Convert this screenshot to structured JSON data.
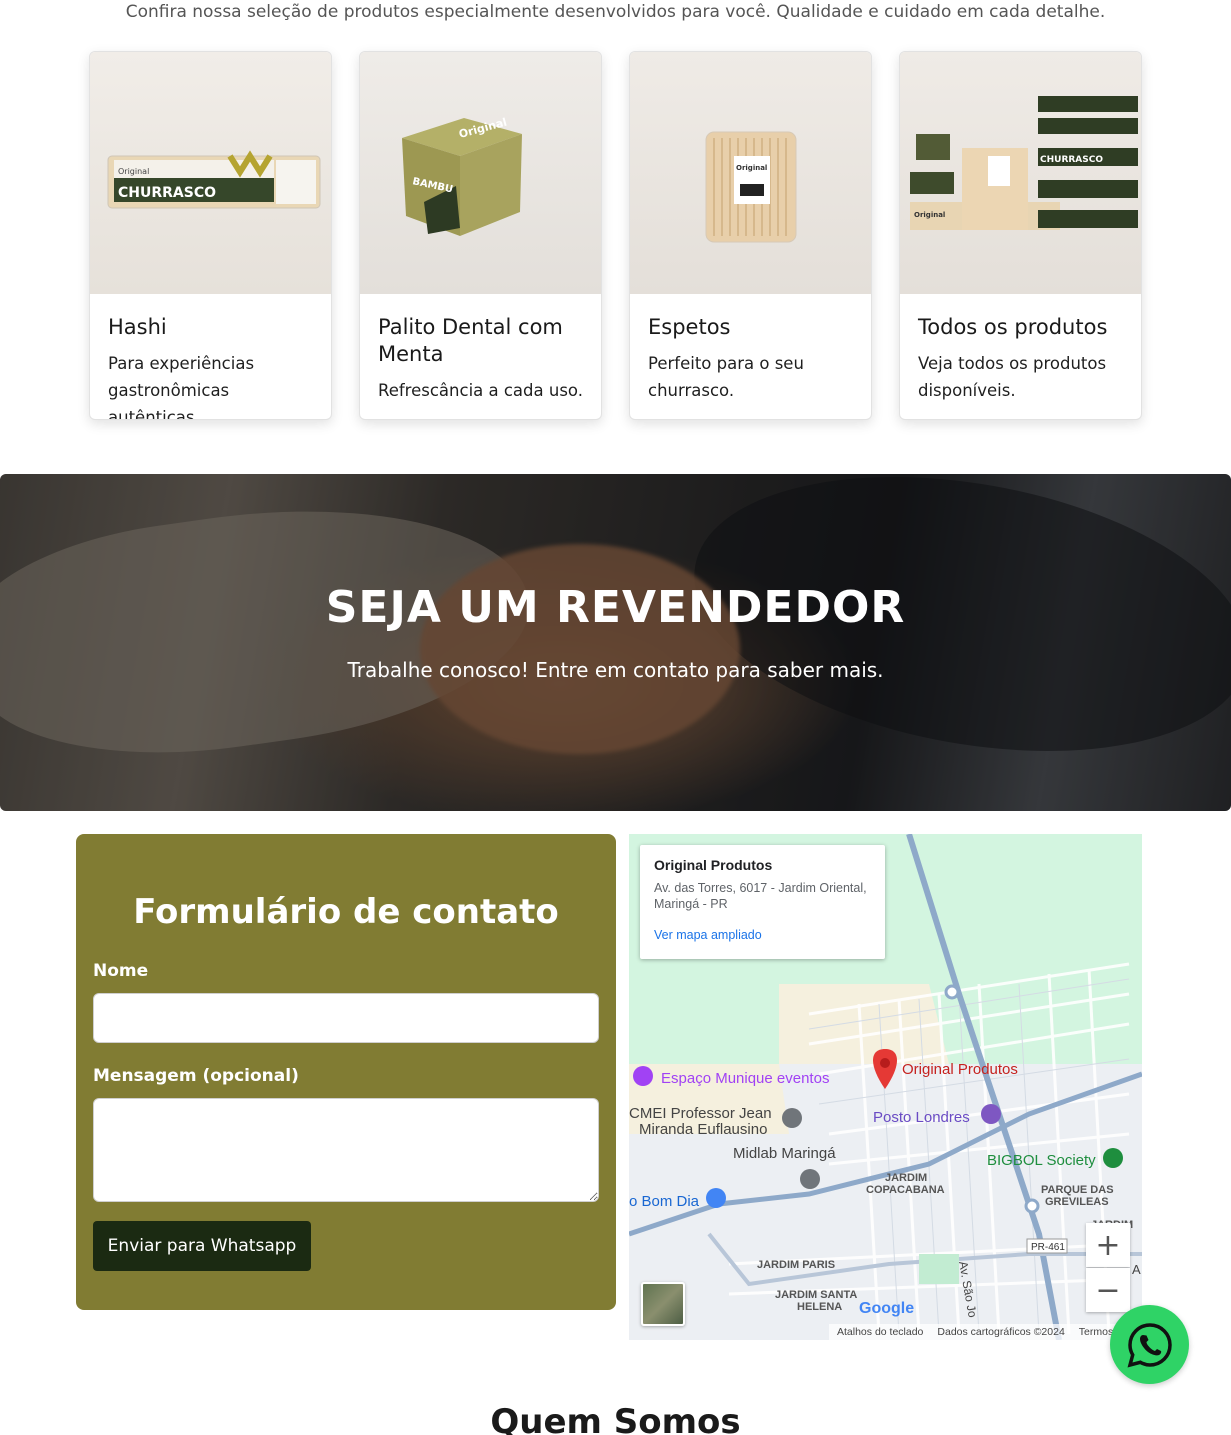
{
  "intro": "Confira nossa seleção de produtos especialmente desenvolvidos para você. Qualidade e cuidado em cada detalhe.",
  "cards": [
    {
      "title": "Hashi",
      "text": "Para experiências gastronômicas autênticas.",
      "image_label": "CHURRASCO",
      "image_brand": "Original"
    },
    {
      "title": "Palito Dental com Menta",
      "text": "Refrescância a cada uso.",
      "image_label": "BAMBU",
      "image_brand": "Original"
    },
    {
      "title": "Espetos",
      "text": "Perfeito para o seu churrasco.",
      "image_label": "",
      "image_brand": "Original"
    },
    {
      "title": "Todos os produtos",
      "text": "Veja todos os produtos disponíveis.",
      "image_label": "CHURRASCO",
      "image_brand": "Original"
    }
  ],
  "reseller": {
    "title": "SEJA UM REVENDEDOR",
    "subtitle": "Trabalhe conosco! Entre em contato para saber mais."
  },
  "form": {
    "title": "Formulário de contato",
    "name_label": "Nome",
    "name_value": "",
    "message_label": "Mensagem (opcional)",
    "message_value": "",
    "submit_label": "Enviar para Whatsapp"
  },
  "map": {
    "place_name": "Original Produtos",
    "address": "Av. das Torres, 6017 - Jardim Oriental, Maringá - PR",
    "link": "Ver mapa ampliado",
    "zoom_in": "+",
    "zoom_out": "−",
    "footer": [
      "Atalhos do teclado",
      "Dados cartográficos ©2024",
      "Termos"
    ],
    "google": "Google",
    "labels": {
      "pin": "Original Produtos",
      "munique": "Espaço Munique eventos",
      "cmei1": "CMEI Professor Jean",
      "cmei2": "Miranda Euflausino",
      "posto": "Posto Londres",
      "midlab": "Midlab Maringá",
      "bigbol": "BIGBOL Society",
      "bomdia": "o Bom Dia",
      "copa1": "JARDIM",
      "copa2": "COPACABANA",
      "grev1": "PARQUE DAS",
      "grev2": "GREVILEAS",
      "paris": "JARDIM PARIS",
      "helena1": "JARDIM SANTA",
      "helena2": "HELENA",
      "road": "PR-461",
      "saojoao": "Av. São Jo",
      "jardim": "JARDIM",
      "a": "A"
    },
    "colors": {
      "green_area": "#d3f5e0",
      "road": "#8ea9c9",
      "pin": "#e53935",
      "poi_purple": "#a142f4",
      "poi_green": "#1e8e3e",
      "poi_blue": "#4285f4"
    }
  },
  "quem_somos": "Quem Somos",
  "colors": {
    "form_bg": "#817c33",
    "button_bg": "#1b2a12",
    "whatsapp": "#2fd366"
  }
}
